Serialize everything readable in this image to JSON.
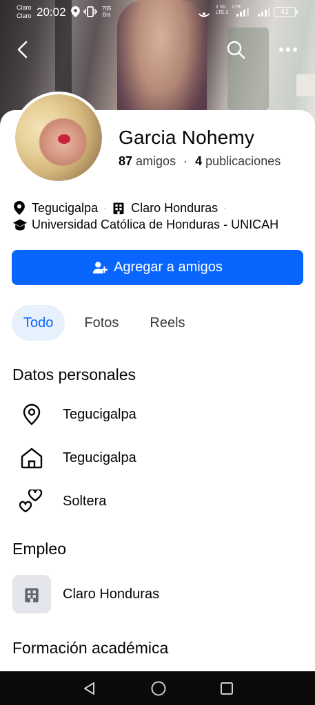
{
  "status_bar": {
    "carrier_1": "Claro",
    "carrier_2": "Claro",
    "time": "20:02",
    "net_speed_value": "765",
    "net_speed_unit": "B/s",
    "volte_top": "1 Vo",
    "volte_bottom": "LTE 2",
    "lte_label": "LTE",
    "battery": "41"
  },
  "profile": {
    "name": "Garcia Nohemy",
    "friends_count": "87",
    "friends_label": "amigos",
    "posts_count": "4",
    "posts_label": "publicaciones"
  },
  "intro": {
    "city": "Tegucigalpa",
    "workplace": "Claro Honduras",
    "education": "Universidad Católica de Honduras - UNICAH"
  },
  "actions": {
    "add_friend": "Agregar a amigos"
  },
  "tabs": [
    {
      "label": "Todo",
      "active": true
    },
    {
      "label": "Fotos",
      "active": false
    },
    {
      "label": "Reels",
      "active": false
    }
  ],
  "personal": {
    "title": "Datos personales",
    "items": [
      {
        "icon": "location-pin-icon",
        "text": "Tegucigalpa"
      },
      {
        "icon": "home-icon",
        "text": "Tegucigalpa"
      },
      {
        "icon": "hearts-icon",
        "text": "Soltera"
      }
    ]
  },
  "employment": {
    "title": "Empleo",
    "company": "Claro Honduras"
  },
  "education_section": {
    "title": "Formación académica"
  },
  "colors": {
    "primary": "#0866ff",
    "tab_active_bg": "#e7f0fd",
    "text": "#050505",
    "muted": "#3b3b3b"
  }
}
